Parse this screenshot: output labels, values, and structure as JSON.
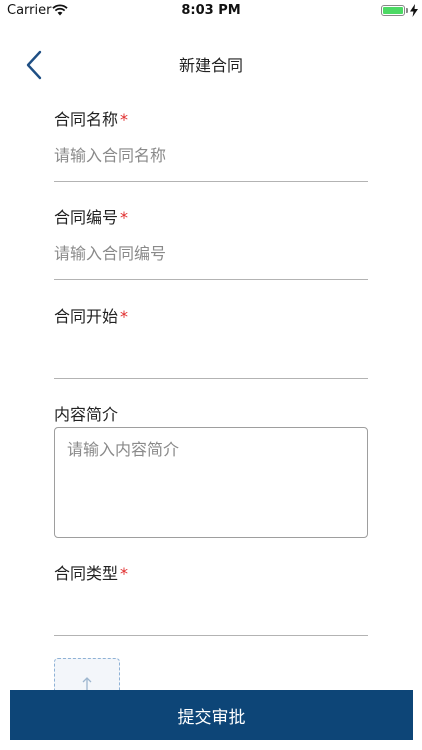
{
  "status_bar": {
    "carrier": "Carrier",
    "time": "8:03 PM",
    "battery_color": "#4cd964"
  },
  "nav": {
    "title": "新建合同",
    "back_icon": "chevron-left-icon",
    "accent": "#1f4f84"
  },
  "form": {
    "contract_name": {
      "label": "合同名称",
      "required_mark": "*",
      "placeholder": "请输入合同名称",
      "value": ""
    },
    "contract_number": {
      "label": "合同编号",
      "required_mark": "*",
      "placeholder": "请输入合同编号",
      "value": ""
    },
    "contract_start": {
      "label": "合同开始",
      "required_mark": "*",
      "value": ""
    },
    "summary": {
      "label": "内容简介",
      "placeholder": "请输入内容简介",
      "value": ""
    },
    "contract_type": {
      "label": "合同类型",
      "required_mark": "*",
      "value": ""
    },
    "upload_icon": "upload-arrow-icon"
  },
  "submit": {
    "label": "提交审批",
    "color": "#0d4577"
  }
}
